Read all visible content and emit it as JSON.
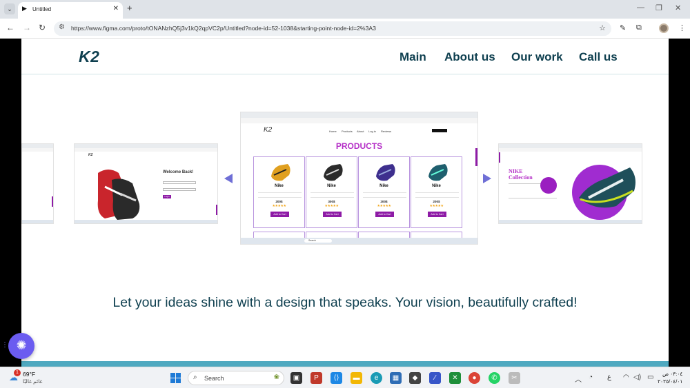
{
  "browser": {
    "tab_title": "Untitled",
    "tab_favicon": "▶",
    "url": "https://www.figma.com/proto/tONANzhQ5j3v1kQ2qpVC2p/Untitled?node-id=52-1038&starting-point-node-id=2%3A3"
  },
  "site": {
    "logo": "K2",
    "nav": [
      "Main",
      "About us",
      "Our work",
      "Call us"
    ],
    "tagline": "Let your ideas shine with a design that speaks. Your vision, beautifully crafted!"
  },
  "carousel": {
    "login_card": {
      "heading": "Welcome Back!",
      "button": "Login"
    },
    "products_card": {
      "logo": "K2",
      "nav": [
        "Home",
        "Products",
        "About",
        "Log in",
        "Reviews"
      ],
      "title": "PRODUCTS",
      "items": [
        {
          "name": "Nike",
          "price": "200$",
          "stars": "★★★★★",
          "button": "Add to Cart",
          "color": "#e0a020"
        },
        {
          "name": "Nike",
          "price": "300$",
          "stars": "★★★★★",
          "button": "Add to Cart",
          "color": "#2b2b2b"
        },
        {
          "name": "Nike",
          "price": "200$",
          "stars": "★★★★★",
          "button": "Add to Cart",
          "color": "#3e2f8e"
        },
        {
          "name": "Nike",
          "price": "200$",
          "stars": "★★★★★",
          "button": "Add to Cart",
          "color": "#1f5f6e"
        }
      ],
      "search_text": "Search"
    },
    "collection_card": {
      "title_line1": "NIKE",
      "title_line2": "Collection"
    }
  },
  "taskbar": {
    "temperature": "69°F",
    "weather_desc": "غائم غالبًا",
    "notification_count": "1",
    "search_placeholder": "Search",
    "lang": "ع",
    "time": "٠٣:٠٤ ص",
    "date": "٢٠٢٥/٠٤/٠١"
  },
  "colors": {
    "brand_dark": "#0e3f4f",
    "accent_purple": "#8e1ba6",
    "arrow": "#6f6fd6",
    "footer": "#4fa9c0",
    "fab": "#6b5cf0"
  }
}
